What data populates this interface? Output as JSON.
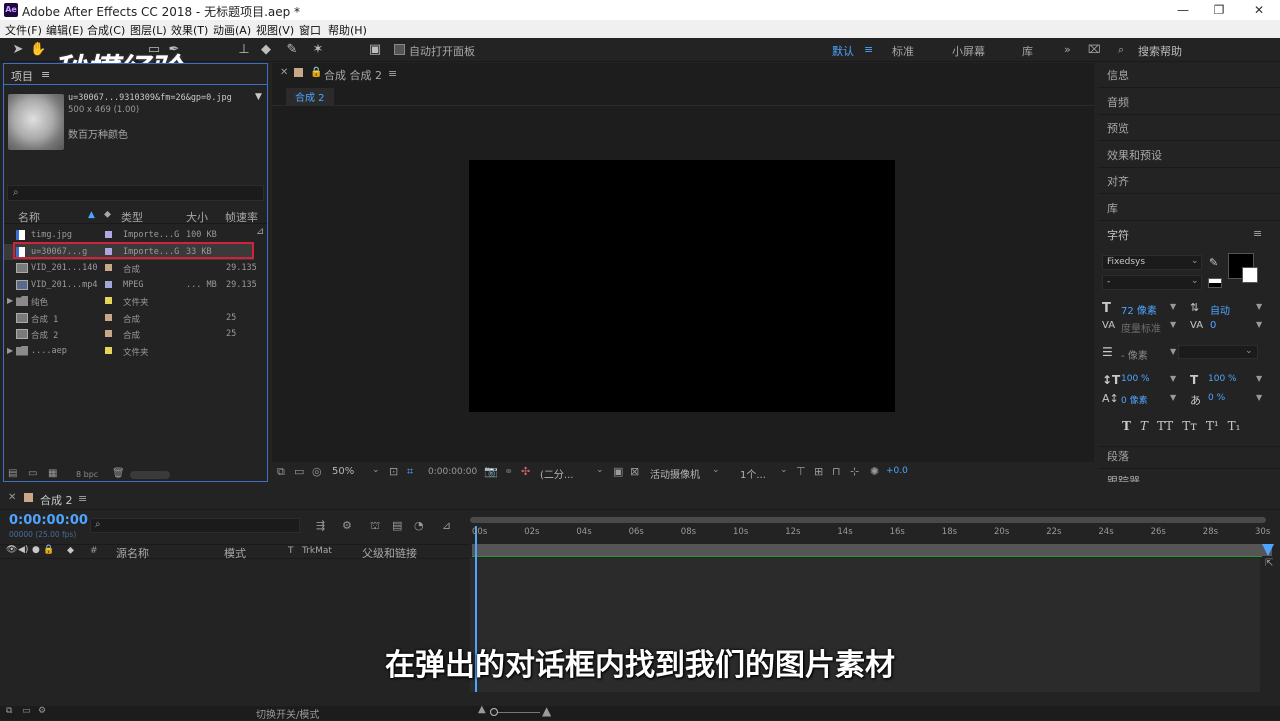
{
  "window": {
    "title": "Adobe After Effects CC 2018 - 无标题项目.aep *",
    "logo": "Ae"
  },
  "menu": [
    "文件(F)",
    "编辑(E)",
    "合成(C)",
    "图层(L)",
    "效果(T)",
    "动画(A)",
    "视图(V)",
    "窗口",
    "帮助(H)"
  ],
  "toolbar": {
    "auto_open_label": "自动打开面板",
    "workspaces": [
      "默认",
      "标准",
      "小屏幕",
      "库"
    ],
    "search_placeholder": "搜索帮助"
  },
  "watermark": "秒懂经验",
  "project": {
    "tab": "项目",
    "selected": {
      "name": "u=30067...9310309&fm=26&gp=0.jpg",
      "dims": "500 x 469 (1.00)",
      "colors": "数百万种颜色"
    },
    "columns": {
      "name": "名称",
      "type": "类型",
      "size": "大小",
      "fps": "帧速率"
    },
    "items": [
      {
        "name": "timg.jpg",
        "type": "Importe...G",
        "size": "100 KB",
        "fps": "",
        "label_color": "#b3a6e0",
        "icon": "image-file-icon"
      },
      {
        "name": "u=30067...g",
        "type": "Importe...G",
        "size": "33 KB",
        "fps": "",
        "label_color": "#b3a6e0",
        "icon": "image-file-icon"
      },
      {
        "name": "VID_201...140",
        "type": "合成",
        "size": "",
        "fps": "29.135",
        "label_color": "#c9a88a",
        "icon": "composition-icon"
      },
      {
        "name": "VID_201...mp4",
        "type": "MPEG",
        "size": "... MB",
        "fps": "29.135",
        "label_color": "#a0a8d8",
        "icon": "video-file-icon"
      },
      {
        "name": "纯色",
        "type": "文件夹",
        "size": "",
        "fps": "",
        "label_color": "#e8d45a",
        "icon": "folder-icon"
      },
      {
        "name": "合成 1",
        "type": "合成",
        "size": "",
        "fps": "25",
        "label_color": "#c9a88a",
        "icon": "composition-icon"
      },
      {
        "name": "合成 2",
        "type": "合成",
        "size": "",
        "fps": "25",
        "label_color": "#c9a88a",
        "icon": "composition-icon"
      },
      {
        "name": "....aep",
        "type": "文件夹",
        "size": "",
        "fps": "",
        "label_color": "#e8d45a",
        "icon": "folder-icon"
      }
    ],
    "bpc": "8 bpc"
  },
  "composition": {
    "panel_title": "合成 合成 2",
    "tab": "合成 2",
    "zoom": "50%",
    "timecode": "0:00:00:00",
    "resolution": "(二分...",
    "camera": "活动摄像机",
    "views": "1个...",
    "exposure": "+0.0"
  },
  "right_panels": {
    "items": [
      "信息",
      "音频",
      "预览",
      "效果和预设",
      "对齐",
      "库"
    ],
    "character": {
      "title": "字符",
      "font": "Fixedsys",
      "style": "-",
      "font_size": "72 像素",
      "leading": "自动",
      "kerning": "度量标准",
      "tracking": "0",
      "stroke": "- 像素",
      "vscale": "100 %",
      "hscale": "100 %",
      "baseline": "0 像素",
      "tsume": "0 %"
    },
    "paragraph": "段落",
    "tracker": "跟踪器"
  },
  "timeline": {
    "tab": "合成 2",
    "timecode": "0:00:00:00",
    "frames": "00000 (25.00 fps)",
    "columns": {
      "num": "#",
      "source": "源名称",
      "mode": "模式",
      "t": "T",
      "trkmat": "TrkMat",
      "parent": "父级和链接"
    },
    "ticks": [
      "00s",
      "02s",
      "04s",
      "06s",
      "08s",
      "10s",
      "12s",
      "14s",
      "16s",
      "18s",
      "20s",
      "22s",
      "24s",
      "26s",
      "28s",
      "30s"
    ],
    "toggle_label": "切换开关/模式"
  },
  "subtitle": "在弹出的对话框内找到我们的图片素材",
  "colors": {
    "accent": "#4ea4ff",
    "selection": "#d0233a"
  }
}
